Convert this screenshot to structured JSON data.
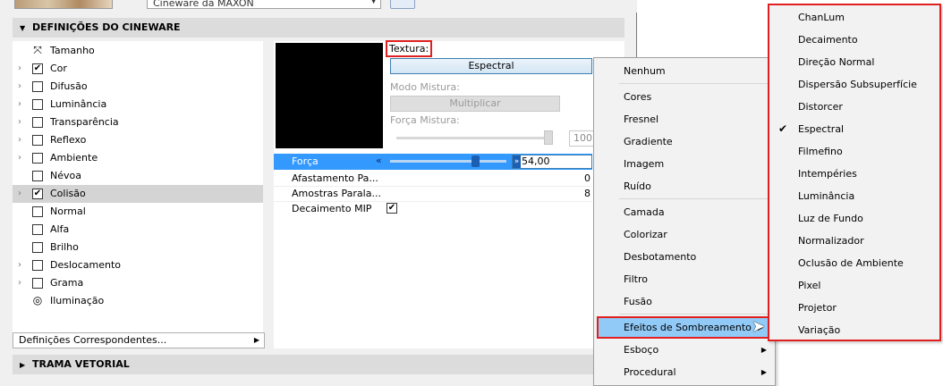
{
  "top": {
    "renderer_value": "Cineware da MAXON"
  },
  "sections": {
    "cineware": "DEFINIÇÕES DO CINEWARE",
    "trama": "TRAMA VETORIAL"
  },
  "channels": [
    {
      "label": "Tamanho",
      "chevron": false,
      "checkbox": "icon",
      "checked": false
    },
    {
      "label": "Cor",
      "chevron": true,
      "checkbox": "box",
      "checked": true
    },
    {
      "label": "Difusão",
      "chevron": true,
      "checkbox": "box",
      "checked": false
    },
    {
      "label": "Luminância",
      "chevron": true,
      "checkbox": "box",
      "checked": false
    },
    {
      "label": "Transparência",
      "chevron": true,
      "checkbox": "box",
      "checked": false
    },
    {
      "label": "Reflexo",
      "chevron": true,
      "checkbox": "box",
      "checked": false
    },
    {
      "label": "Ambiente",
      "chevron": true,
      "checkbox": "box",
      "checked": false
    },
    {
      "label": "Névoa",
      "chevron": false,
      "checkbox": "box",
      "checked": false
    },
    {
      "label": "Colisão",
      "chevron": true,
      "checkbox": "box",
      "checked": true
    },
    {
      "label": "Normal",
      "chevron": false,
      "checkbox": "box",
      "checked": false
    },
    {
      "label": "Alfa",
      "chevron": false,
      "checkbox": "box",
      "checked": false
    },
    {
      "label": "Brilho",
      "chevron": false,
      "checkbox": "box",
      "checked": false
    },
    {
      "label": "Deslocamento",
      "chevron": true,
      "checkbox": "box",
      "checked": false
    },
    {
      "label": "Grama",
      "chevron": true,
      "checkbox": "box",
      "checked": false
    },
    {
      "label": "Iluminação",
      "chevron": false,
      "checkbox": "icon",
      "checked": false
    }
  ],
  "corr": "Definições Correspondentes...",
  "texture": {
    "label": "Textura:",
    "button": "Espectral",
    "modo_label": "Modo Mistura:",
    "modo_value": "Multiplicar",
    "forca_mistura_label": "Força Mistura:",
    "forca_mistura_value": "100,"
  },
  "props": {
    "forca_label": "Força",
    "forca_value": "54,00",
    "forca_level": 0.7,
    "afast_label": "Afastamento Pa...",
    "afast_value": "0",
    "amostras_label": "Amostras Parala...",
    "amostras_value": "8",
    "mip_label": "Decaimento MIP",
    "mip_checked": true
  },
  "menu1": [
    {
      "label": "Nenhum",
      "sub": false
    },
    {
      "sep": true
    },
    {
      "label": "Cores",
      "sub": false
    },
    {
      "label": "Fresnel",
      "sub": false
    },
    {
      "label": "Gradiente",
      "sub": false
    },
    {
      "label": "Imagem",
      "sub": false
    },
    {
      "label": "Ruído",
      "sub": false
    },
    {
      "sep": true
    },
    {
      "label": "Camada",
      "sub": false
    },
    {
      "label": "Colorizar",
      "sub": false
    },
    {
      "label": "Desbotamento",
      "sub": false
    },
    {
      "label": "Filtro",
      "sub": false
    },
    {
      "label": "Fusão",
      "sub": false
    },
    {
      "sep": true
    },
    {
      "label": "Efeitos de Sombreamento",
      "sub": true,
      "highlight": true
    },
    {
      "label": "Esboço",
      "sub": true
    },
    {
      "label": "Procedural",
      "sub": true
    }
  ],
  "menu2": [
    {
      "label": "ChanLum"
    },
    {
      "label": "Decaimento"
    },
    {
      "label": "Direção Normal"
    },
    {
      "label": "Dispersão Subsuperfície"
    },
    {
      "label": "Distorcer"
    },
    {
      "label": "Espectral",
      "checked": true
    },
    {
      "label": "Filmefino"
    },
    {
      "label": "Intempéries"
    },
    {
      "label": "Luminância"
    },
    {
      "label": "Luz de Fundo"
    },
    {
      "label": "Normalizador"
    },
    {
      "label": "Oclusão de Ambiente"
    },
    {
      "label": "Pixel"
    },
    {
      "label": "Projetor"
    },
    {
      "label": "Variação"
    }
  ]
}
